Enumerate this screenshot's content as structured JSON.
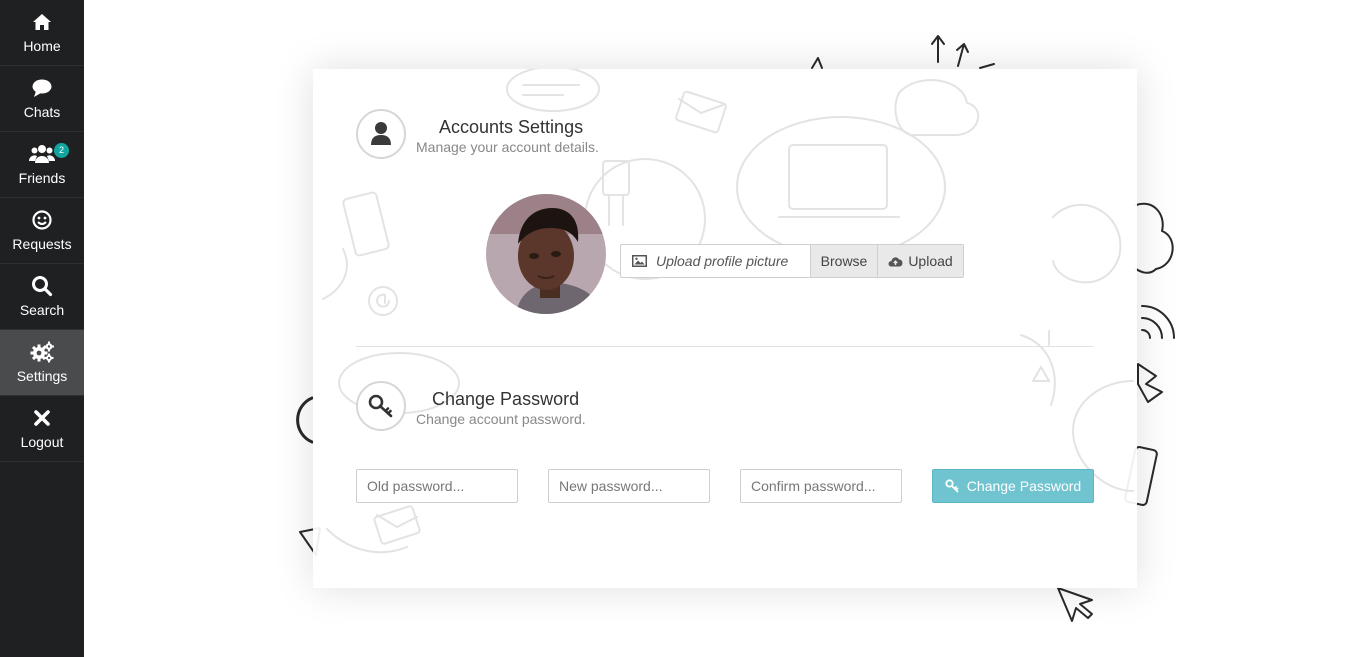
{
  "sidebar": {
    "items": [
      {
        "label": "Home",
        "icon": "home-icon"
      },
      {
        "label": "Chats",
        "icon": "chat-bubble-icon"
      },
      {
        "label": "Friends",
        "icon": "users-icon",
        "badge": "2"
      },
      {
        "label": "Requests",
        "icon": "smile-icon"
      },
      {
        "label": "Search",
        "icon": "search-icon"
      },
      {
        "label": "Settings",
        "icon": "gears-icon",
        "active": true
      },
      {
        "label": "Logout",
        "icon": "close-icon"
      }
    ]
  },
  "account": {
    "title": "Accounts Settings",
    "subtitle": "Manage your account details.",
    "icon": "user-icon"
  },
  "upload": {
    "placeholder": "Upload profile picture",
    "browse_label": "Browse",
    "upload_label": "Upload"
  },
  "password": {
    "title": "Change Password",
    "subtitle": "Change account password.",
    "icon": "key-icon",
    "old_placeholder": "Old password...",
    "new_placeholder": "New password...",
    "confirm_placeholder": "Confirm password...",
    "button_label": "Change Password"
  },
  "colors": {
    "sidebar_bg": "#1f2022",
    "sidebar_active": "#4a4b4d",
    "badge": "#11a5a0",
    "button_accent": "#6fc4d0"
  }
}
